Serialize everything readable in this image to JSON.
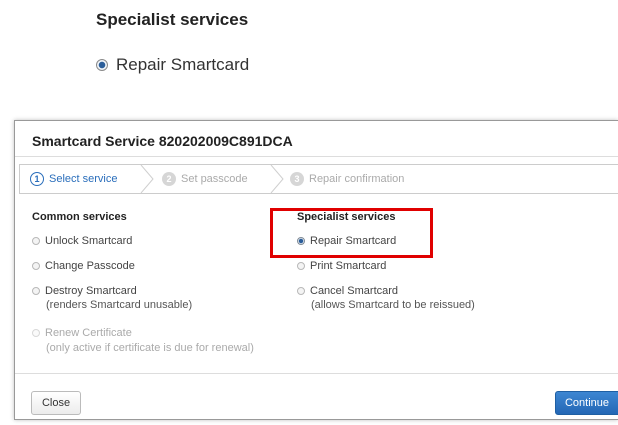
{
  "callout": {
    "title": "Specialist services",
    "option_label": "Repair Smartcard"
  },
  "dialog": {
    "title": "Smartcard Service 820202009C891DCA",
    "steps": [
      {
        "num": "1",
        "label": "Select service"
      },
      {
        "num": "2",
        "label": "Set passcode"
      },
      {
        "num": "3",
        "label": "Repair confirmation"
      }
    ],
    "common": {
      "heading": "Common services",
      "options": [
        {
          "label": "Unlock Smartcard"
        },
        {
          "label": "Change Passcode"
        },
        {
          "label": "Destroy Smartcard",
          "note": "(renders Smartcard unusable)"
        },
        {
          "label": "Renew Certificate",
          "note": "(only active if certificate is due for renewal)"
        }
      ]
    },
    "specialist": {
      "heading": "Specialist services",
      "options": [
        {
          "label": "Repair Smartcard"
        },
        {
          "label": "Print Smartcard"
        },
        {
          "label": "Cancel Smartcard",
          "note": "(allows Smartcard to be reissued)"
        }
      ]
    },
    "buttons": {
      "close": "Close",
      "continue": "Continue"
    }
  },
  "colors": {
    "accent": "#2a6ebb",
    "highlight": "#e00000",
    "primary_button": "#2467b5"
  },
  "state": {
    "active_step": 1,
    "selected_service": "Repair Smartcard",
    "disabled_options": [
      "Renew Certificate"
    ]
  }
}
